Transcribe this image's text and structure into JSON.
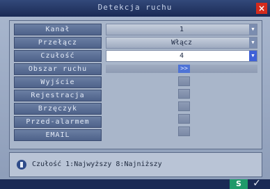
{
  "window": {
    "title": "Detekcja ruchu",
    "close_icon": "×"
  },
  "labels": [
    "Kanał",
    "Przełącz",
    "Czułość",
    "Obszar ruchu",
    "Wyjście",
    "Rejestracja",
    "Brzęczyk",
    "Przed-alarmem",
    "EMAIL"
  ],
  "controls": {
    "channel": "1",
    "switch": "Włącz",
    "sensitivity": "4",
    "area_picker_icon": ">>"
  },
  "hint": {
    "text": "Czułość  1:Najwyższy 8:Najniższy"
  },
  "footer": {
    "ok_label": "S",
    "confirm_icon": "✓"
  },
  "colors": {
    "accent": "#3f61d8",
    "close": "#d42a1c",
    "ok": "#1f9a6a"
  }
}
